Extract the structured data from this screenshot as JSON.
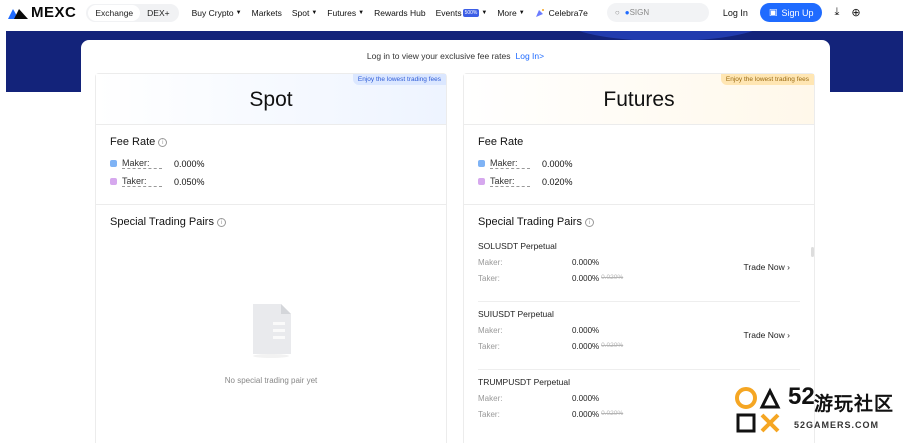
{
  "nav": {
    "brand": "MEXC",
    "segments": [
      "Exchange",
      "DEX+"
    ],
    "items": [
      {
        "label": "Buy Crypto",
        "caret": true
      },
      {
        "label": "Markets",
        "caret": false
      },
      {
        "label": "Spot",
        "caret": true
      },
      {
        "label": "Futures",
        "caret": true
      },
      {
        "label": "Rewards Hub",
        "caret": false
      },
      {
        "label": "Events",
        "caret": true,
        "tag": "500%"
      },
      {
        "label": "More",
        "caret": true
      },
      {
        "label": "Celebra7e",
        "caret": false
      }
    ],
    "search_placeholder": "SIGN",
    "login": "Log In",
    "signup": "Sign Up"
  },
  "login_prompt": {
    "text": "Log in to view your exclusive fee rates",
    "link": "Log In>"
  },
  "spot": {
    "title": "Spot",
    "tag": "Enjoy the lowest trading fees",
    "fee_title": "Fee Rate",
    "maker_label": "Maker:",
    "maker": "0.000%",
    "taker_label": "Taker:",
    "taker": "0.050%",
    "special_title": "Special Trading Pairs",
    "empty_text": "No special trading pair yet"
  },
  "futures": {
    "title": "Futures",
    "tag": "Enjoy the lowest trading fees",
    "fee_title": "Fee Rate",
    "maker_label": "Maker:",
    "maker": "0.000%",
    "taker_label": "Taker:",
    "taker": "0.020%",
    "special_title": "Special Trading Pairs",
    "pairs": [
      {
        "name": "SOLUSDT Perpetual",
        "maker_label": "Maker:",
        "maker": "0.000%",
        "taker_label": "Taker:",
        "taker": "0.000%",
        "taker_old": "0.020%",
        "action": "Trade Now"
      },
      {
        "name": "SUIUSDT Perpetual",
        "maker_label": "Maker:",
        "maker": "0.000%",
        "taker_label": "Taker:",
        "taker": "0.000%",
        "taker_old": "0.020%",
        "action": "Trade Now"
      },
      {
        "name": "TRUMPUSDT Perpetual",
        "maker_label": "Maker:",
        "maker": "0.000%",
        "taker_label": "Taker:",
        "taker": "0.000%",
        "taker_old": "0.020%",
        "action": ""
      }
    ]
  },
  "watermark": {
    "big": "52",
    "cn": "游玩社区",
    "en": "52GAMERS.COM"
  },
  "colors": {
    "accent": "#1f6bff",
    "banner": "#13237a"
  }
}
